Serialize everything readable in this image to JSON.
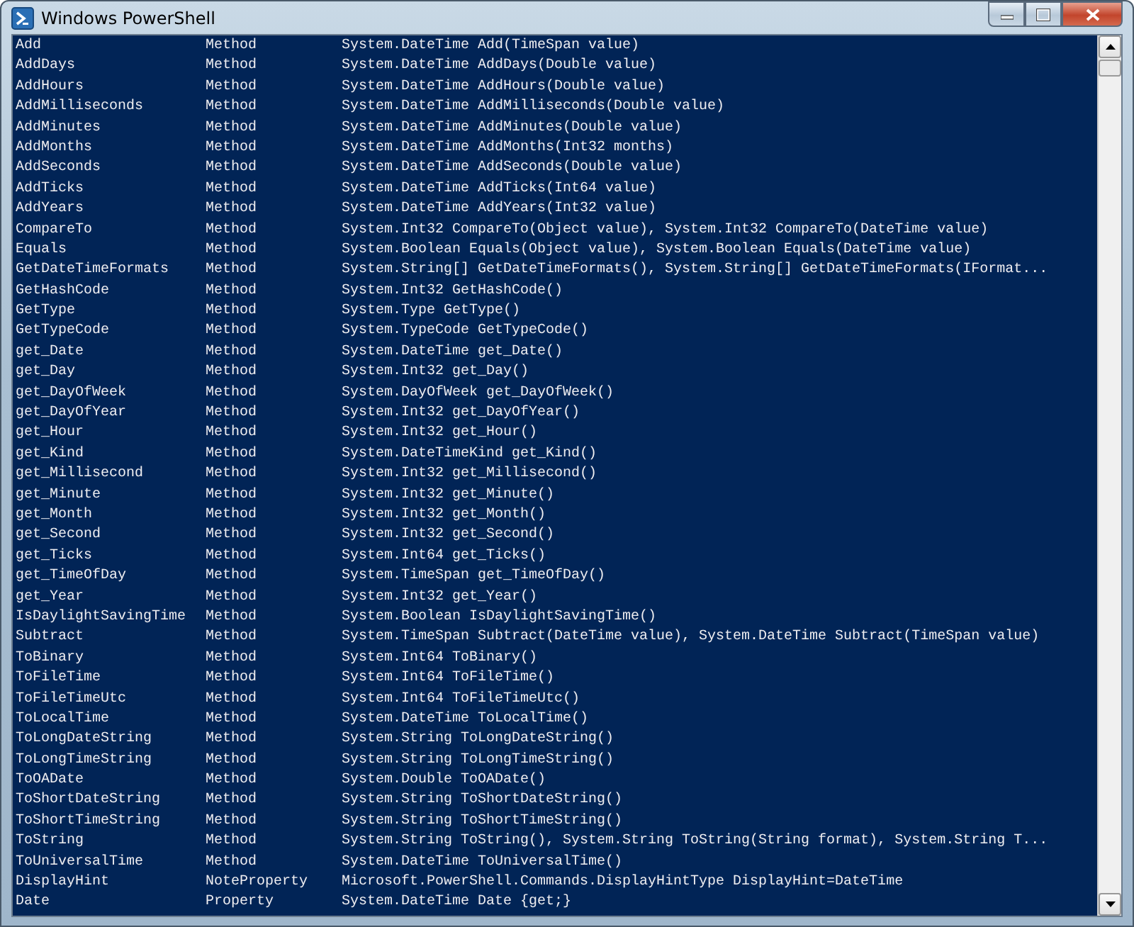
{
  "window": {
    "title": "Windows PowerShell"
  },
  "rows": [
    {
      "name": "Add",
      "type": "Method",
      "definition": "System.DateTime Add(TimeSpan value)"
    },
    {
      "name": "AddDays",
      "type": "Method",
      "definition": "System.DateTime AddDays(Double value)"
    },
    {
      "name": "AddHours",
      "type": "Method",
      "definition": "System.DateTime AddHours(Double value)"
    },
    {
      "name": "AddMilliseconds",
      "type": "Method",
      "definition": "System.DateTime AddMilliseconds(Double value)"
    },
    {
      "name": "AddMinutes",
      "type": "Method",
      "definition": "System.DateTime AddMinutes(Double value)"
    },
    {
      "name": "AddMonths",
      "type": "Method",
      "definition": "System.DateTime AddMonths(Int32 months)"
    },
    {
      "name": "AddSeconds",
      "type": "Method",
      "definition": "System.DateTime AddSeconds(Double value)"
    },
    {
      "name": "AddTicks",
      "type": "Method",
      "definition": "System.DateTime AddTicks(Int64 value)"
    },
    {
      "name": "AddYears",
      "type": "Method",
      "definition": "System.DateTime AddYears(Int32 value)"
    },
    {
      "name": "CompareTo",
      "type": "Method",
      "definition": "System.Int32 CompareTo(Object value), System.Int32 CompareTo(DateTime value)"
    },
    {
      "name": "Equals",
      "type": "Method",
      "definition": "System.Boolean Equals(Object value), System.Boolean Equals(DateTime value)"
    },
    {
      "name": "GetDateTimeFormats",
      "type": "Method",
      "definition": "System.String[] GetDateTimeFormats(), System.String[] GetDateTimeFormats(IFormat..."
    },
    {
      "name": "GetHashCode",
      "type": "Method",
      "definition": "System.Int32 GetHashCode()"
    },
    {
      "name": "GetType",
      "type": "Method",
      "definition": "System.Type GetType()"
    },
    {
      "name": "GetTypeCode",
      "type": "Method",
      "definition": "System.TypeCode GetTypeCode()"
    },
    {
      "name": "get_Date",
      "type": "Method",
      "definition": "System.DateTime get_Date()"
    },
    {
      "name": "get_Day",
      "type": "Method",
      "definition": "System.Int32 get_Day()"
    },
    {
      "name": "get_DayOfWeek",
      "type": "Method",
      "definition": "System.DayOfWeek get_DayOfWeek()"
    },
    {
      "name": "get_DayOfYear",
      "type": "Method",
      "definition": "System.Int32 get_DayOfYear()"
    },
    {
      "name": "get_Hour",
      "type": "Method",
      "definition": "System.Int32 get_Hour()"
    },
    {
      "name": "get_Kind",
      "type": "Method",
      "definition": "System.DateTimeKind get_Kind()"
    },
    {
      "name": "get_Millisecond",
      "type": "Method",
      "definition": "System.Int32 get_Millisecond()"
    },
    {
      "name": "get_Minute",
      "type": "Method",
      "definition": "System.Int32 get_Minute()"
    },
    {
      "name": "get_Month",
      "type": "Method",
      "definition": "System.Int32 get_Month()"
    },
    {
      "name": "get_Second",
      "type": "Method",
      "definition": "System.Int32 get_Second()"
    },
    {
      "name": "get_Ticks",
      "type": "Method",
      "definition": "System.Int64 get_Ticks()"
    },
    {
      "name": "get_TimeOfDay",
      "type": "Method",
      "definition": "System.TimeSpan get_TimeOfDay()"
    },
    {
      "name": "get_Year",
      "type": "Method",
      "definition": "System.Int32 get_Year()"
    },
    {
      "name": "IsDaylightSavingTime",
      "type": "Method",
      "definition": "System.Boolean IsDaylightSavingTime()"
    },
    {
      "name": "Subtract",
      "type": "Method",
      "definition": "System.TimeSpan Subtract(DateTime value), System.DateTime Subtract(TimeSpan value)"
    },
    {
      "name": "ToBinary",
      "type": "Method",
      "definition": "System.Int64 ToBinary()"
    },
    {
      "name": "ToFileTime",
      "type": "Method",
      "definition": "System.Int64 ToFileTime()"
    },
    {
      "name": "ToFileTimeUtc",
      "type": "Method",
      "definition": "System.Int64 ToFileTimeUtc()"
    },
    {
      "name": "ToLocalTime",
      "type": "Method",
      "definition": "System.DateTime ToLocalTime()"
    },
    {
      "name": "ToLongDateString",
      "type": "Method",
      "definition": "System.String ToLongDateString()"
    },
    {
      "name": "ToLongTimeString",
      "type": "Method",
      "definition": "System.String ToLongTimeString()"
    },
    {
      "name": "ToOADate",
      "type": "Method",
      "definition": "System.Double ToOADate()"
    },
    {
      "name": "ToShortDateString",
      "type": "Method",
      "definition": "System.String ToShortDateString()"
    },
    {
      "name": "ToShortTimeString",
      "type": "Method",
      "definition": "System.String ToShortTimeString()"
    },
    {
      "name": "ToString",
      "type": "Method",
      "definition": "System.String ToString(), System.String ToString(String format), System.String T..."
    },
    {
      "name": "ToUniversalTime",
      "type": "Method",
      "definition": "System.DateTime ToUniversalTime()"
    },
    {
      "name": "DisplayHint",
      "type": "NoteProperty",
      "definition": "Microsoft.PowerShell.Commands.DisplayHintType DisplayHint=DateTime"
    },
    {
      "name": "Date",
      "type": "Property",
      "definition": "System.DateTime Date {get;}"
    }
  ]
}
